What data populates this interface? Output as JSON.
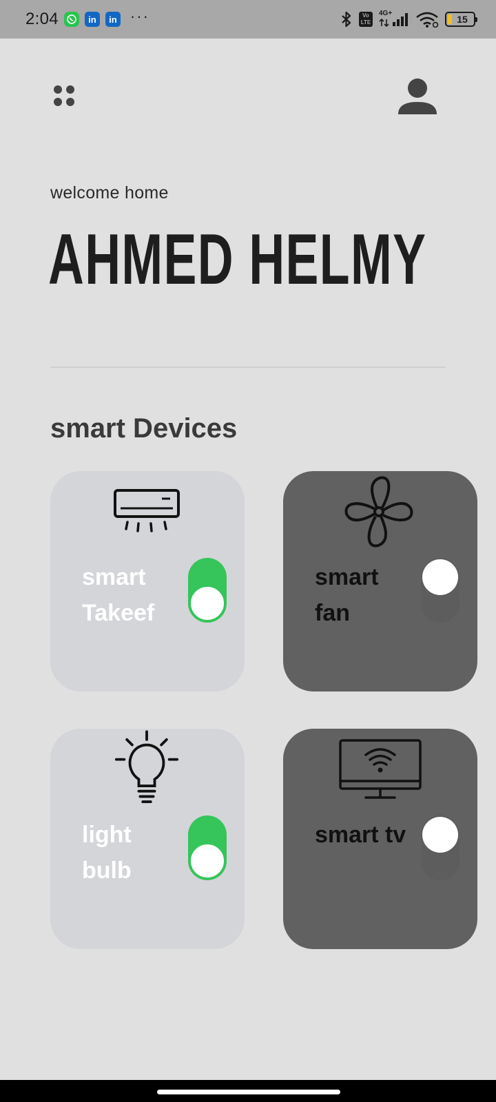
{
  "status_bar": {
    "time": "2:04",
    "app_badges": [
      "whatsapp-icon",
      "linkedin-icon",
      "linkedin-icon"
    ],
    "more": "···",
    "network": "4G+",
    "volte": "Vo LTE",
    "battery": "15"
  },
  "header": {
    "welcome": "welcome home",
    "user_name": "AHMED HELMY"
  },
  "devices_section": {
    "title": "smart Devices",
    "devices": [
      {
        "name": "smart Takeef",
        "icon": "air-conditioner-icon",
        "powered": true
      },
      {
        "name": "smart fan",
        "icon": "fan-icon",
        "powered": false
      },
      {
        "name": "light bulb",
        "icon": "light-bulb-icon",
        "powered": true
      },
      {
        "name": "smart tv",
        "icon": "smart-tv-icon",
        "powered": false
      }
    ]
  },
  "colors": {
    "background": "#e0e0e0",
    "card_light": "#d4d5d9",
    "card_dark": "#616161",
    "switch_on": "#35c55a"
  }
}
